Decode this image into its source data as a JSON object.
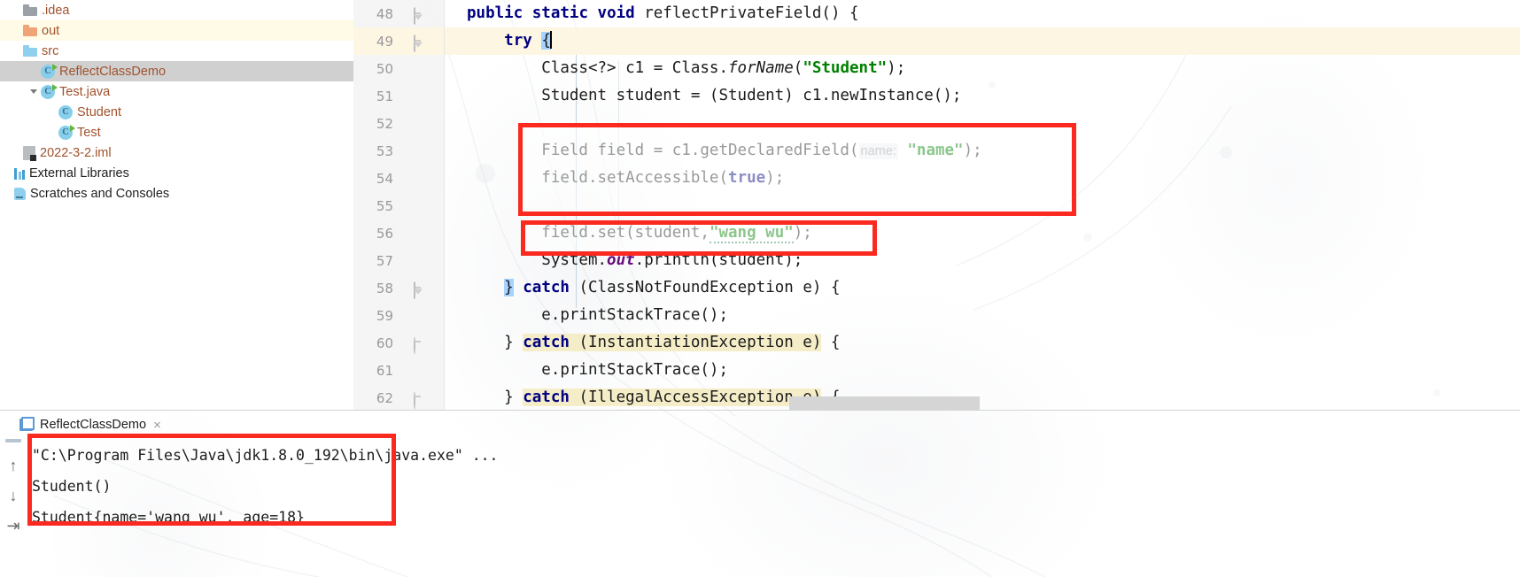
{
  "project_tree": {
    "items": [
      {
        "label": ".idea",
        "icon": "folder-grey-icon",
        "indent": 0,
        "state": "normal",
        "twisty": "none"
      },
      {
        "label": "out",
        "icon": "folder-orange-icon",
        "indent": 0,
        "state": "highlighted",
        "twisty": "none"
      },
      {
        "label": "src",
        "icon": "folder-blue-icon",
        "indent": 0,
        "state": "normal",
        "twisty": "none"
      },
      {
        "label": "ReflectClassDemo",
        "icon": "java-class-run-icon",
        "indent": 1,
        "state": "selected",
        "twisty": "none"
      },
      {
        "label": "Test.java",
        "icon": "java-class-run-icon",
        "indent": 1,
        "state": "normal",
        "twisty": "expanded"
      },
      {
        "label": "Student",
        "icon": "java-class-icon",
        "indent": 2,
        "state": "normal",
        "twisty": "none"
      },
      {
        "label": "Test",
        "icon": "java-class-run-icon",
        "indent": 2,
        "state": "normal",
        "twisty": "none"
      },
      {
        "label": "2022-3-2.iml",
        "icon": "iml-file-icon",
        "indent": 0,
        "state": "normal",
        "twisty": "none"
      },
      {
        "label": "External Libraries",
        "icon": "libraries-icon",
        "indent": -1,
        "state": "dark",
        "twisty": "none"
      },
      {
        "label": "Scratches and Consoles",
        "icon": "scratches-icon",
        "indent": -1,
        "state": "dark",
        "twisty": "none"
      }
    ]
  },
  "editor": {
    "line_numbers": [
      "48",
      "49",
      "50",
      "51",
      "52",
      "53",
      "54",
      "55",
      "56",
      "57",
      "58",
      "59",
      "60",
      "61",
      "62"
    ],
    "lines": [
      {
        "n": "48",
        "text": "public static void reflectPrivateField() {"
      },
      {
        "n": "49",
        "text": "    try {"
      },
      {
        "n": "50",
        "text": "        Class<?> c1 = Class.forName(\"Student\");"
      },
      {
        "n": "51",
        "text": "        Student student = (Student) c1.newInstance();"
      },
      {
        "n": "52",
        "text": ""
      },
      {
        "n": "53",
        "text": "        Field field = c1.getDeclaredField( name: \"name\");"
      },
      {
        "n": "54",
        "text": "        field.setAccessible(true);"
      },
      {
        "n": "55",
        "text": ""
      },
      {
        "n": "56",
        "text": "        field.set(student,\"wang wu\");"
      },
      {
        "n": "57",
        "text": "        System.out.println(student);"
      },
      {
        "n": "58",
        "text": "    } catch (ClassNotFoundException e) {"
      },
      {
        "n": "59",
        "text": "        e.printStackTrace();"
      },
      {
        "n": "60",
        "text": "    } catch (InstantiationException e) {"
      },
      {
        "n": "61",
        "text": "        e.printStackTrace();"
      },
      {
        "n": "62",
        "text": "    } catch (IllegalAccessException e) {"
      }
    ],
    "parameter_hint": "name:"
  },
  "run_panel": {
    "tab_label": "ReflectClassDemo",
    "close_label": "×",
    "toolbar": {
      "up_label": "↑",
      "down_label": "↓",
      "soft_wrap_label": "⇥"
    },
    "output": [
      "\"C:\\Program Files\\Java\\jdk1.8.0_192\\bin\\java.exe\" ...",
      "Student()",
      "Student{name='wang wu', age=18}"
    ]
  },
  "colors": {
    "annotation_red": "#fa2a20",
    "keyword_blue": "#000080",
    "string_green": "#008000",
    "static_field_purple": "#660e7a",
    "selection_row_yellow": "#fdf6e3",
    "tree_selected_grey": "#d0d0d0",
    "tree_label_brown": "#a0522d",
    "console_cmd_green_bg": "#e9f3e6",
    "highlight_occurrence": "#f5edc8"
  }
}
